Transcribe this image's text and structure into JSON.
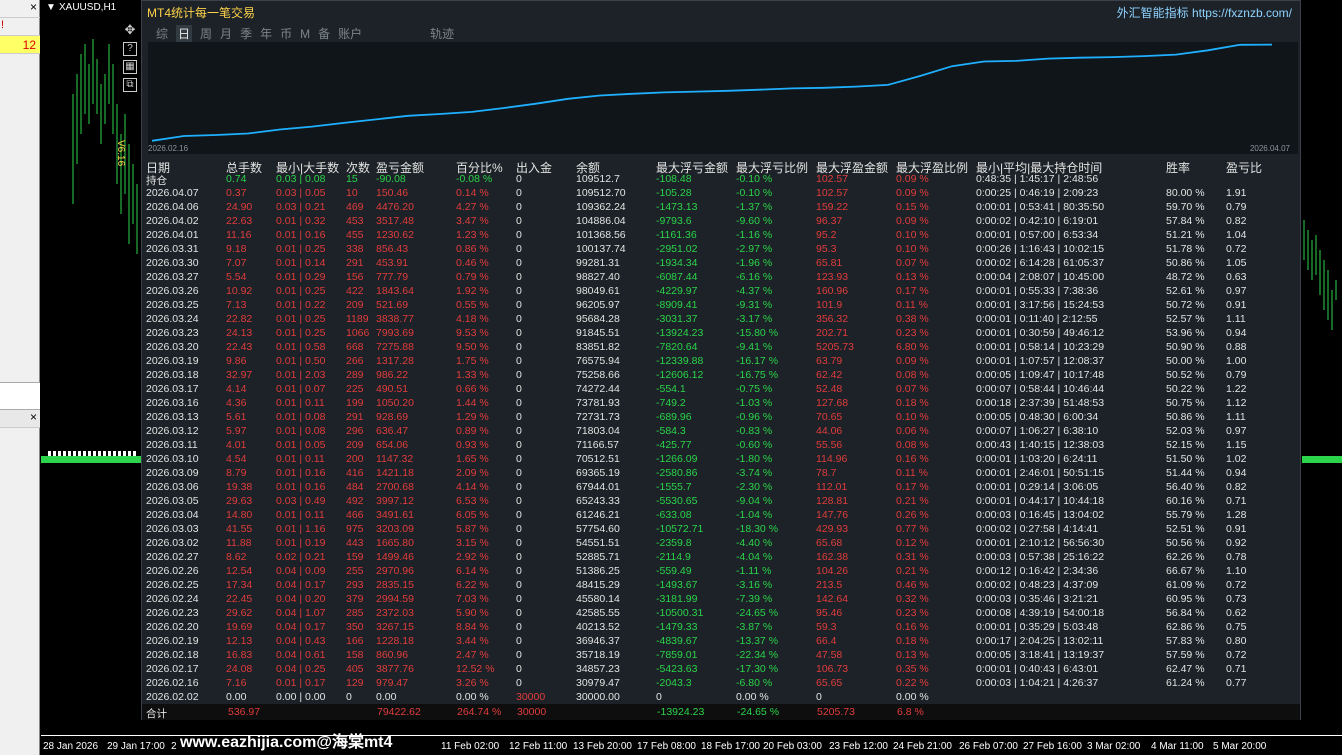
{
  "chart_header": {
    "symbol": "XAUUSD,H1",
    "marker": "▼"
  },
  "left_panel": {
    "close_top": "×",
    "value": "12",
    "bang": "!",
    "close_mid": "×"
  },
  "side_tools": {
    "move": "✥",
    "help": "?",
    "grid": "▦",
    "copy": "⧉",
    "version": "V6.16"
  },
  "panel": {
    "title": "MT4统计每一笔交易",
    "ad_text": "外汇智能指标",
    "ad_url": "https://fxznzb.com/",
    "tabs": [
      "综",
      "日",
      "周",
      "月",
      "季",
      "年",
      "币",
      "M",
      "备",
      "账户",
      "轨迹"
    ],
    "active_tab": "日",
    "equity_start": "2026.02.16",
    "equity_end": "2026.04.07",
    "equity_series": [
      30979.47,
      34857.23,
      35718.19,
      36946.37,
      40213.52,
      42585.55,
      45580.14,
      48415.29,
      51386.25,
      52885.71,
      54551.51,
      57754.6,
      61246.21,
      65243.33,
      67944.01,
      69365.19,
      70512.51,
      71166.57,
      71803.04,
      72731.73,
      73781.93,
      74272.44,
      75258.66,
      76575.94,
      83851.82,
      91845.51,
      95684.28,
      96205.97,
      98049.61,
      98827.4,
      99281.31,
      100137.74,
      101368.56,
      104886.04,
      109362.24,
      109512.7
    ],
    "columns": [
      "日期",
      "总手数",
      "最小|大手数",
      "次数",
      "盈亏金额",
      "百分比%",
      "出入金",
      "余额",
      "最大浮亏金额",
      "最大浮亏比例",
      "最大浮盈金额",
      "最大浮盈比例",
      "最小|平均|最大持仓时间",
      "胜率",
      "盈亏比"
    ],
    "holding": {
      "date": "持仓",
      "lots": "0.74",
      "minmax": "0.03 | 0.08",
      "count": "15",
      "pnl": "-90.08",
      "pct": "-0.08 %",
      "io": "0",
      "balance": "109512.7",
      "fl": "-108.48",
      "flp": "-0.10 %",
      "fp": "102.57",
      "fpp": "0.09 %",
      "time": "0:48:35 | 1:45:17 | 2:48:56"
    },
    "rows": [
      [
        "2026.04.07",
        "0.37",
        "0.03 | 0.05",
        "10",
        "150.46",
        "0.14 %",
        "0",
        "109512.70",
        "-105.28",
        "-0.10 %",
        "102.57",
        "0.09 %",
        "0:00:25 | 0:46:19 | 2:09:23",
        "80.00 %",
        "1.91"
      ],
      [
        "2026.04.06",
        "24.90",
        "0.03 | 0.21",
        "469",
        "4476.20",
        "4.27 %",
        "0",
        "109362.24",
        "-1473.13",
        "-1.37 %",
        "159.22",
        "0.15 %",
        "0:00:01 | 0:53:41 | 80:35:50",
        "59.70 %",
        "0.79"
      ],
      [
        "2026.04.02",
        "22.63",
        "0.01 | 0.32",
        "453",
        "3517.48",
        "3.47 %",
        "0",
        "104886.04",
        "-9793.6",
        "-9.60 %",
        "96.37",
        "0.09 %",
        "0:00:02 | 0:42:10 | 6:19:01",
        "57.84 %",
        "0.82"
      ],
      [
        "2026.04.01",
        "11.16",
        "0.01 | 0.16",
        "455",
        "1230.62",
        "1.23 %",
        "0",
        "101368.56",
        "-1161.36",
        "-1.16 %",
        "95.2",
        "0.10 %",
        "0:00:01 | 0:57:00 | 6:53:34",
        "51.21 %",
        "1.04"
      ],
      [
        "2026.03.31",
        "9.18",
        "0.01 | 0.25",
        "338",
        "856.43",
        "0.86 %",
        "0",
        "100137.74",
        "-2951.02",
        "-2.97 %",
        "95.3",
        "0.10 %",
        "0:00:26 | 1:16:43 | 10:02:15",
        "51.78 %",
        "0.72"
      ],
      [
        "2026.03.30",
        "7.07",
        "0.01 | 0.14",
        "291",
        "453.91",
        "0.46 %",
        "0",
        "99281.31",
        "-1934.34",
        "-1.96 %",
        "65.81",
        "0.07 %",
        "0:00:02 | 6:14:28 | 61:05:37",
        "50.86 %",
        "1.05"
      ],
      [
        "2026.03.27",
        "5.54",
        "0.01 | 0.29",
        "156",
        "777.79",
        "0.79 %",
        "0",
        "98827.40",
        "-6087.44",
        "-6.16 %",
        "123.93",
        "0.13 %",
        "0:00:04 | 2:08:07 | 10:45:00",
        "48.72 %",
        "0.63"
      ],
      [
        "2026.03.26",
        "10.92",
        "0.01 | 0.25",
        "422",
        "1843.64",
        "1.92 %",
        "0",
        "98049.61",
        "-4229.97",
        "-4.37 %",
        "160.96",
        "0.17 %",
        "0:00:01 | 0:55:33 | 7:38:36",
        "52.61 %",
        "0.97"
      ],
      [
        "2026.03.25",
        "7.13",
        "0.01 | 0.22",
        "209",
        "521.69",
        "0.55 %",
        "0",
        "96205.97",
        "-8909.41",
        "-9.31 %",
        "101.9",
        "0.11 %",
        "0:00:01 | 3:17:56 | 15:24:53",
        "50.72 %",
        "0.91"
      ],
      [
        "2026.03.24",
        "22.82",
        "0.01 | 0.25",
        "1189",
        "3838.77",
        "4.18 %",
        "0",
        "95684.28",
        "-3031.37",
        "-3.17 %",
        "356.32",
        "0.38 %",
        "0:00:01 | 0:11:40 | 2:12:55",
        "52.57 %",
        "1.11"
      ],
      [
        "2026.03.23",
        "24.13",
        "0.01 | 0.25",
        "1066",
        "7993.69",
        "9.53 %",
        "0",
        "91845.51",
        "-13924.23",
        "-15.80 %",
        "202.71",
        "0.23 %",
        "0:00:01 | 0:30:59 | 49:46:12",
        "53.96 %",
        "0.94"
      ],
      [
        "2026.03.20",
        "22.43",
        "0.01 | 0.58",
        "668",
        "7275.88",
        "9.50 %",
        "0",
        "83851.82",
        "-7820.64",
        "-9.41 %",
        "5205.73",
        "6.80 %",
        "0:00:01 | 0:58:14 | 10:23:29",
        "50.90 %",
        "0.88"
      ],
      [
        "2026.03.19",
        "9.86",
        "0.01 | 0.50",
        "266",
        "1317.28",
        "1.75 %",
        "0",
        "76575.94",
        "-12339.88",
        "-16.17 %",
        "63.79",
        "0.09 %",
        "0:00:01 | 1:07:57 | 12:08:37",
        "50.00 %",
        "1.00"
      ],
      [
        "2026.03.18",
        "32.97",
        "0.01 | 2.03",
        "289",
        "986.22",
        "1.33 %",
        "0",
        "75258.66",
        "-12606.12",
        "-16.75 %",
        "62.42",
        "0.08 %",
        "0:00:05 | 1:09:47 | 10:17:48",
        "50.52 %",
        "0.79"
      ],
      [
        "2026.03.17",
        "4.14",
        "0.01 | 0.07",
        "225",
        "490.51",
        "0.66 %",
        "0",
        "74272.44",
        "-554.1",
        "-0.75 %",
        "52.48",
        "0.07 %",
        "0:00:07 | 0:58:44 | 10:46:44",
        "50.22 %",
        "1.22"
      ],
      [
        "2026.03.16",
        "4.36",
        "0.01 | 0.11",
        "199",
        "1050.20",
        "1.44 %",
        "0",
        "73781.93",
        "-749.2",
        "-1.03 %",
        "127.68",
        "0.18 %",
        "0:00:18 | 2:37:39 | 51:48:53",
        "50.75 %",
        "1.12"
      ],
      [
        "2026.03.13",
        "5.61",
        "0.01 | 0.08",
        "291",
        "928.69",
        "1.29 %",
        "0",
        "72731.73",
        "-689.96",
        "-0.96 %",
        "70.65",
        "0.10 %",
        "0:00:05 | 0:48:30 | 6:00:34",
        "50.86 %",
        "1.11"
      ],
      [
        "2026.03.12",
        "5.97",
        "0.01 | 0.08",
        "296",
        "636.47",
        "0.89 %",
        "0",
        "71803.04",
        "-584.3",
        "-0.83 %",
        "44.06",
        "0.06 %",
        "0:00:07 | 1:06:27 | 6:38:10",
        "52.03 %",
        "0.97"
      ],
      [
        "2026.03.11",
        "4.01",
        "0.01 | 0.05",
        "209",
        "654.06",
        "0.93 %",
        "0",
        "71166.57",
        "-425.77",
        "-0.60 %",
        "55.56",
        "0.08 %",
        "0:00:43 | 1:40:15 | 12:38:03",
        "52.15 %",
        "1.15"
      ],
      [
        "2026.03.10",
        "4.54",
        "0.01 | 0.11",
        "200",
        "1147.32",
        "1.65 %",
        "0",
        "70512.51",
        "-1266.09",
        "-1.80 %",
        "114.96",
        "0.16 %",
        "0:00:01 | 1:03:20 | 6:24:11",
        "51.50 %",
        "1.02"
      ],
      [
        "2026.03.09",
        "8.79",
        "0.01 | 0.16",
        "416",
        "1421.18",
        "2.09 %",
        "0",
        "69365.19",
        "-2580.86",
        "-3.74 %",
        "78.7",
        "0.11 %",
        "0:00:01 | 2:46:01 | 50:51:15",
        "51.44 %",
        "0.94"
      ],
      [
        "2026.03.06",
        "19.38",
        "0.01 | 0.16",
        "484",
        "2700.68",
        "4.14 %",
        "0",
        "67944.01",
        "-1555.7",
        "-2.30 %",
        "112.01",
        "0.17 %",
        "0:00:01 | 0:29:14 | 3:06:05",
        "56.40 %",
        "0.82"
      ],
      [
        "2026.03.05",
        "29.63",
        "0.03 | 0.49",
        "492",
        "3997.12",
        "6.53 %",
        "0",
        "65243.33",
        "-5530.65",
        "-9.04 %",
        "128.81",
        "0.21 %",
        "0:00:01 | 0:44:17 | 10:44:18",
        "60.16 %",
        "0.71"
      ],
      [
        "2026.03.04",
        "14.80",
        "0.01 | 0.11",
        "466",
        "3491.61",
        "6.05 %",
        "0",
        "61246.21",
        "-633.08",
        "-1.04 %",
        "147.76",
        "0.26 %",
        "0:00:03 | 0:16:45 | 13:04:02",
        "55.79 %",
        "1.28"
      ],
      [
        "2026.03.03",
        "41.55",
        "0.01 | 1.16",
        "975",
        "3203.09",
        "5.87 %",
        "0",
        "57754.60",
        "-10572.71",
        "-18.30 %",
        "429.93",
        "0.77 %",
        "0:00:02 | 0:27:58 | 4:14:41",
        "52.51 %",
        "0.91"
      ],
      [
        "2026.03.02",
        "11.88",
        "0.01 | 0.19",
        "443",
        "1665.80",
        "3.15 %",
        "0",
        "54551.51",
        "-2359.8",
        "-4.40 %",
        "65.68",
        "0.12 %",
        "0:00:01 | 2:10:12 | 56:56:30",
        "50.56 %",
        "0.92"
      ],
      [
        "2026.02.27",
        "8.62",
        "0.02 | 0.21",
        "159",
        "1499.46",
        "2.92 %",
        "0",
        "52885.71",
        "-2114.9",
        "-4.04 %",
        "162.38",
        "0.31 %",
        "0:00:03 | 0:57:38 | 25:16:22",
        "62.26 %",
        "0.78"
      ],
      [
        "2026.02.26",
        "12.54",
        "0.04 | 0.09",
        "255",
        "2970.96",
        "6.14 %",
        "0",
        "51386.25",
        "-559.49",
        "-1.11 %",
        "104.26",
        "0.21 %",
        "0:00:12 | 0:16:42 | 2:34:36",
        "66.67 %",
        "1.10"
      ],
      [
        "2026.02.25",
        "17.34",
        "0.04 | 0.17",
        "293",
        "2835.15",
        "6.22 %",
        "0",
        "48415.29",
        "-1493.67",
        "-3.16 %",
        "213.5",
        "0.46 %",
        "0:00:02 | 0:48:23 | 4:37:09",
        "61.09 %",
        "0.72"
      ],
      [
        "2026.02.24",
        "22.45",
        "0.04 | 0.20",
        "379",
        "2994.59",
        "7.03 %",
        "0",
        "45580.14",
        "-3181.99",
        "-7.39 %",
        "142.64",
        "0.32 %",
        "0:00:03 | 0:35:46 | 3:21:21",
        "60.95 %",
        "0.73"
      ],
      [
        "2026.02.23",
        "29.62",
        "0.04 | 1.07",
        "285",
        "2372.03",
        "5.90 %",
        "0",
        "42585.55",
        "-10500.31",
        "-24.65 %",
        "95.46",
        "0.23 %",
        "0:00:08 | 4:39:19 | 54:00:18",
        "56.84 %",
        "0.62"
      ],
      [
        "2026.02.20",
        "19.69",
        "0.04 | 0.17",
        "350",
        "3267.15",
        "8.84 %",
        "0",
        "40213.52",
        "-1479.33",
        "-3.87 %",
        "59.3",
        "0.16 %",
        "0:00:01 | 0:35:29 | 5:03:48",
        "62.86 %",
        "0.75"
      ],
      [
        "2026.02.19",
        "12.13",
        "0.04 | 0.43",
        "166",
        "1228.18",
        "3.44 %",
        "0",
        "36946.37",
        "-4839.67",
        "-13.37 %",
        "66.4",
        "0.18 %",
        "0:00:17 | 2:04:25 | 13:02:11",
        "57.83 %",
        "0.80"
      ],
      [
        "2026.02.18",
        "16.83",
        "0.04 | 0.61",
        "158",
        "860.96",
        "2.47 %",
        "0",
        "35718.19",
        "-7859.01",
        "-22.34 %",
        "47.58",
        "0.13 %",
        "0:00:05 | 3:18:41 | 13:19:37",
        "57.59 %",
        "0.72"
      ],
      [
        "2026.02.17",
        "24.08",
        "0.04 | 0.25",
        "405",
        "3877.76",
        "12.52 %",
        "0",
        "34857.23",
        "-5423.63",
        "-17.30 %",
        "106.73",
        "0.35 %",
        "0:00:01 | 0:40:43 | 6:43:01",
        "62.47 %",
        "0.71"
      ],
      [
        "2026.02.16",
        "7.16",
        "0.01 | 0.17",
        "129",
        "979.47",
        "3.26 %",
        "0",
        "30979.47",
        "-2043.3",
        "-6.80 %",
        "65.65",
        "0.22 %",
        "0:00:03 | 1:04:21 | 4:26:37",
        "61.24 %",
        "0.77"
      ],
      [
        "2026.02.02",
        "0.00",
        "0.00 | 0.00",
        "0",
        "0.00",
        "0.00 %",
        "30000",
        "30000.00",
        "0",
        "0.00 %",
        "0",
        "0.00 %",
        "",
        "",
        ""
      ]
    ],
    "total": {
      "label": "合计",
      "lots": "536.97",
      "pnl": "79422.62",
      "pct": "264.74 %",
      "io": "30000",
      "fl": "-13924.23",
      "flp": "-24.65 %",
      "fp": "5205.73",
      "fpp": "6.8 %"
    }
  },
  "xaxis": [
    "28 Jan 2026",
    "29 Jan 17:00",
    "2",
    "11 Feb 02:00",
    "12 Feb 11:00",
    "13 Feb 20:00",
    "17 Feb 08:00",
    "18 Feb 17:00",
    "20 Feb 03:00",
    "23 Feb 12:00",
    "24 Feb 21:00",
    "26 Feb 07:00",
    "27 Feb 16:00",
    "3 Mar 02:00",
    "4 Mar 11:00",
    "5 Mar 20:00"
  ],
  "watermark": "www.eazhijia.com@海棠mt4"
}
